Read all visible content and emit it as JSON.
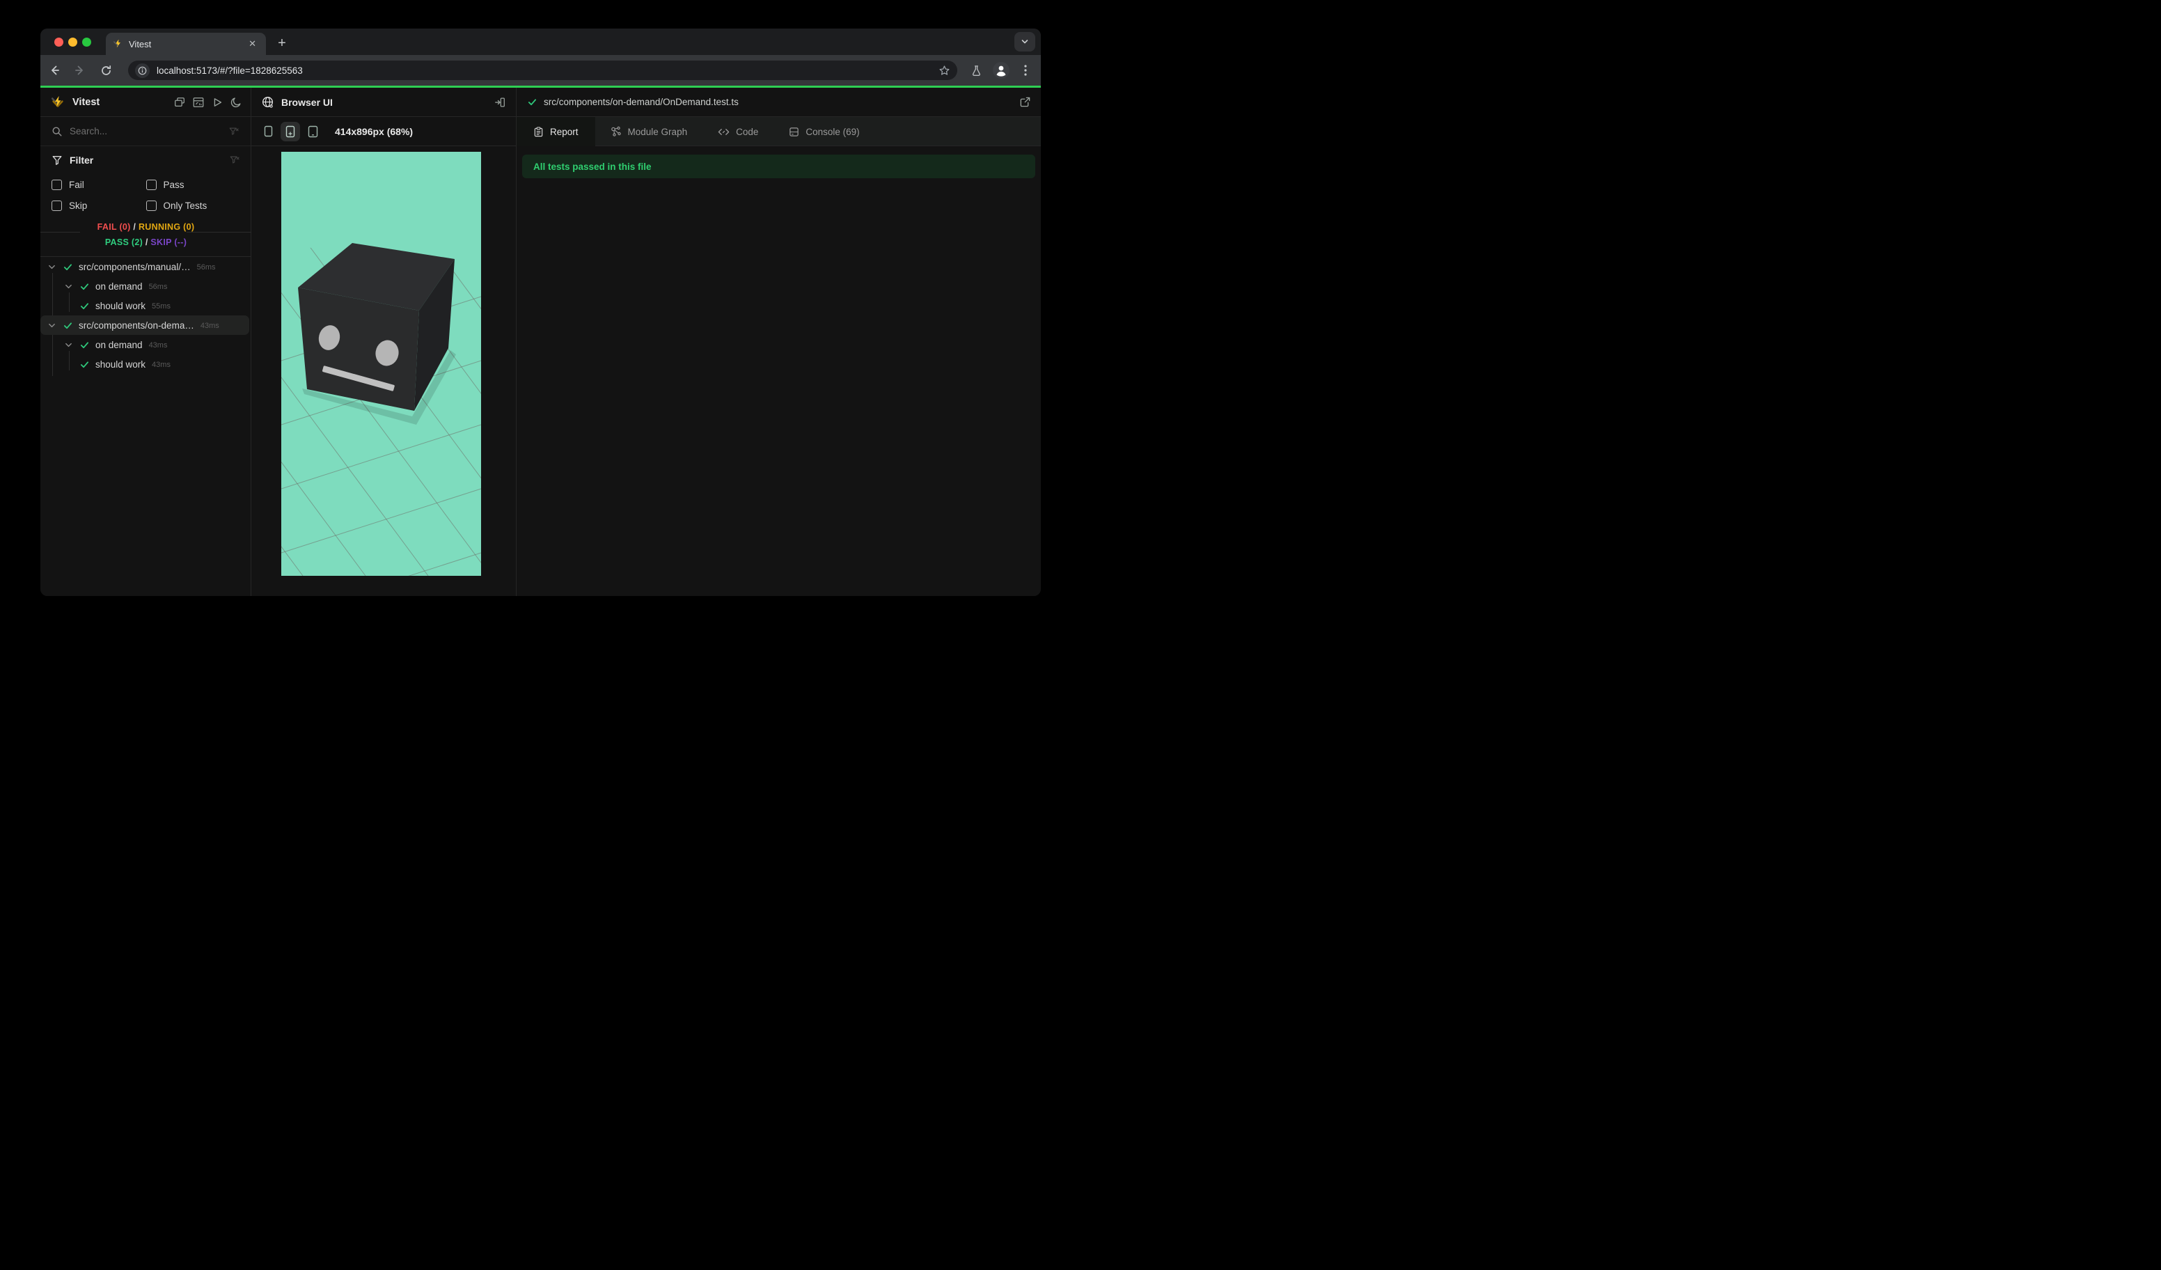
{
  "browser": {
    "tab_title": "Vitest",
    "close_glyph": "✕",
    "new_tab_glyph": "+",
    "url": "localhost:5173/#/?file=1828625563",
    "accent_line_color": "#2ece53",
    "traffic_colors": [
      "#ff5f57",
      "#febc2e",
      "#28c840"
    ]
  },
  "sidebar": {
    "app_title": "Vitest",
    "toolbar_icons": [
      "collapse-panels",
      "dashboard",
      "run-all",
      "dark-mode"
    ],
    "search": {
      "placeholder": "Search..."
    },
    "filter": {
      "title": "Filter",
      "options": [
        {
          "label": "Fail",
          "checked": false
        },
        {
          "label": "Pass",
          "checked": false
        },
        {
          "label": "Skip",
          "checked": false
        },
        {
          "label": "Only Tests",
          "checked": false
        }
      ]
    },
    "summary": {
      "fail": "FAIL (0)",
      "running": "RUNNING (0)",
      "pass": "PASS (2)",
      "skip": "SKIP (--)",
      "separator": "/",
      "colors": {
        "fail": "#f24e4e",
        "running": "#e2a712",
        "pass": "#2fce7f",
        "skip": "#7a45c8"
      }
    },
    "tree": [
      {
        "label": "src/components/manual/…",
        "duration": "56ms",
        "depth": 0,
        "expandable": true,
        "selected": false
      },
      {
        "label": "on demand",
        "duration": "56ms",
        "depth": 1,
        "expandable": true,
        "selected": false
      },
      {
        "label": "should work",
        "duration": "55ms",
        "depth": 2,
        "expandable": false,
        "selected": false
      },
      {
        "label": "src/components/on-dema…",
        "duration": "43ms",
        "depth": 0,
        "expandable": true,
        "selected": true
      },
      {
        "label": "on demand",
        "duration": "43ms",
        "depth": 1,
        "expandable": true,
        "selected": false
      },
      {
        "label": "should work",
        "duration": "43ms",
        "depth": 2,
        "expandable": false,
        "selected": false
      }
    ]
  },
  "preview": {
    "title": "Browser UI",
    "viewport_label": "414x896px (68%)",
    "devices": [
      "phone-small",
      "phone-large",
      "tablet"
    ],
    "selected_device_index": 1,
    "scene": {
      "background": "#7edcbe",
      "grid_color": "#6d6f68",
      "cube_front": "#2a2b2c",
      "cube_top": "#2d2e30",
      "cube_right": "#202123",
      "eye_color": "#b5b5b5",
      "mouth_color": "#c0c0c0"
    }
  },
  "report": {
    "file_path": "src/components/on-demand/OnDemand.test.ts",
    "tabs": [
      {
        "label": "Report",
        "active": true
      },
      {
        "label": "Module Graph",
        "active": false
      },
      {
        "label": "Code",
        "active": false
      },
      {
        "label": "Console (69)",
        "active": false
      }
    ],
    "banner": {
      "text": "All tests passed in this file"
    }
  }
}
